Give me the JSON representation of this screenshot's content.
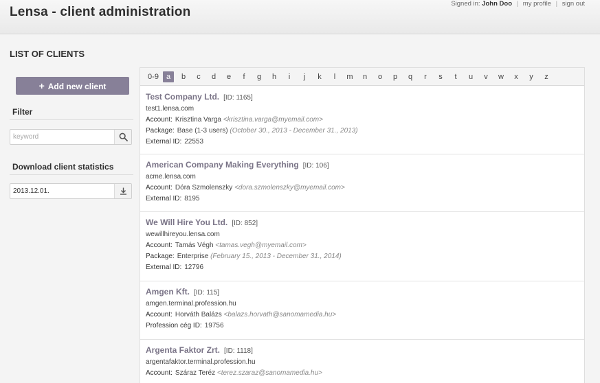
{
  "app": {
    "title": "Lensa - client administration",
    "signed_in_label": "Signed in:",
    "user_name": "John Doo",
    "my_profile": "my profile",
    "sign_out": "sign out"
  },
  "page_title": "LIST OF CLIENTS",
  "sidebar": {
    "add_label": "Add new client",
    "filter_heading": "Filter",
    "keyword_placeholder": "keyword",
    "download_heading": "Download client statistics",
    "date_value": "2013.12.01."
  },
  "alphabet": {
    "items": [
      "0-9",
      "a",
      "b",
      "c",
      "d",
      "e",
      "f",
      "g",
      "h",
      "i",
      "j",
      "k",
      "l",
      "m",
      "n",
      "o",
      "p",
      "q",
      "r",
      "s",
      "t",
      "u",
      "v",
      "w",
      "x",
      "y",
      "z"
    ],
    "active": "a"
  },
  "labels": {
    "account": "Account:",
    "package": "Package:",
    "external_id": "External ID:",
    "profession_id": "Profession cég ID:"
  },
  "clients": [
    {
      "name": "Test Company Ltd.",
      "id": "[ID: 1165]",
      "domain": "test1.lensa.com",
      "account_name": "Krisztina Varga",
      "account_email": "<krisztina.varga@myemail.com>",
      "package": "Base (1-3 users)",
      "package_period": "(October 30., 2013 - December 31., 2013)",
      "external_id": "22553"
    },
    {
      "name": "American Company Making Everything",
      "id": "[ID: 106]",
      "domain": "acme.lensa.com",
      "account_name": "Dóra Szmolenszky",
      "account_email": "<dora.szmolenszky@myemail.com>",
      "external_id": "8195"
    },
    {
      "name": "We Will Hire You Ltd.",
      "id": "[ID: 852]",
      "domain": "wewillhireyou.lensa.com",
      "account_name": "Tamás Végh",
      "account_email": "<tamas.vegh@myemail.com>",
      "package": "Enterprise",
      "package_period": "(February 15., 2013 - December 31., 2014)",
      "external_id": "12796"
    },
    {
      "name": "Amgen Kft.",
      "id": "[ID: 115]",
      "domain": "amgen.terminal.profession.hu",
      "account_name": "Horváth Balázs",
      "account_email": "<balazs.horvath@sanomamedia.hu>",
      "profession_id": "19756"
    },
    {
      "name": "Argenta Faktor Zrt.",
      "id": "[ID: 1118]",
      "domain": "argentafaktor.terminal.profession.hu",
      "account_name": "Száraz Teréz",
      "account_email": "<terez.szaraz@sanomamedia.hu>"
    }
  ]
}
